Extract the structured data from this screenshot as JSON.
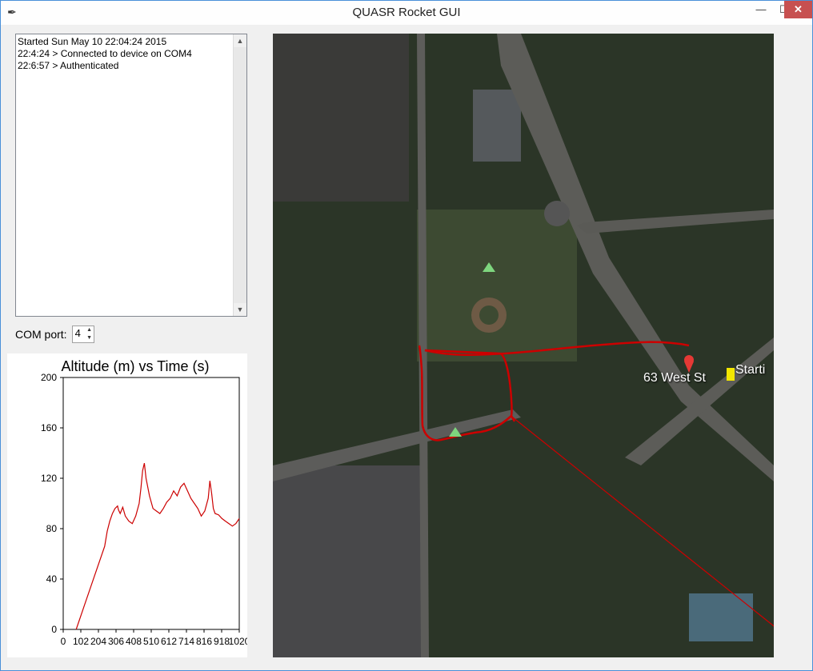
{
  "window": {
    "title": "QUASR Rocket GUI",
    "app_icon": "feather-icon",
    "buttons": {
      "minimize": "—",
      "maximize": "☐",
      "close": "✕"
    }
  },
  "log": {
    "lines": [
      "Started Sun May 10 22:04:24 2015",
      "22:4:24 > Connected to device on COM4",
      "22:6:57 > Authenticated"
    ]
  },
  "com_port": {
    "label": "COM port:",
    "value": "4"
  },
  "chart_data": {
    "type": "line",
    "title": "Altitude (m) vs Time (s)",
    "xlabel": "",
    "ylabel": "",
    "ylim": [
      0,
      200
    ],
    "yticks": [
      0,
      40,
      80,
      120,
      160,
      200
    ],
    "xtick_labels": [
      "0",
      "102",
      "204",
      "306",
      "408",
      "510",
      "612",
      "714",
      "816",
      "918",
      "1020"
    ],
    "xlim": [
      0,
      1020
    ],
    "series": [
      {
        "color": "#cc0000",
        "x": [
          75,
          120,
          180,
          240,
          255,
          270,
          285,
          300,
          315,
          320,
          330,
          345,
          360,
          380,
          400,
          420,
          440,
          450,
          460,
          470,
          480,
          500,
          520,
          540,
          560,
          580,
          600,
          620,
          640,
          660,
          680,
          700,
          720,
          740,
          760,
          780,
          800,
          820,
          840,
          850,
          860,
          870,
          880,
          900,
          920,
          940,
          960,
          980,
          1000,
          1020
        ],
        "y": [
          0,
          18,
          42,
          66,
          78,
          86,
          92,
          96,
          98,
          95,
          92,
          97,
          90,
          86,
          84,
          90,
          100,
          112,
          126,
          132,
          120,
          106,
          96,
          94,
          92,
          96,
          101,
          104,
          110,
          106,
          113,
          116,
          110,
          104,
          100,
          96,
          90,
          94,
          104,
          118,
          108,
          96,
          92,
          91,
          88,
          86,
          84,
          82,
          84,
          88
        ]
      }
    ],
    "grid": false
  },
  "map": {
    "labels": {
      "address": "63 West St",
      "start": "Starti"
    },
    "track_color": "#cc0000",
    "marker_color": "#e53935",
    "pin_color": "#f2e600"
  }
}
